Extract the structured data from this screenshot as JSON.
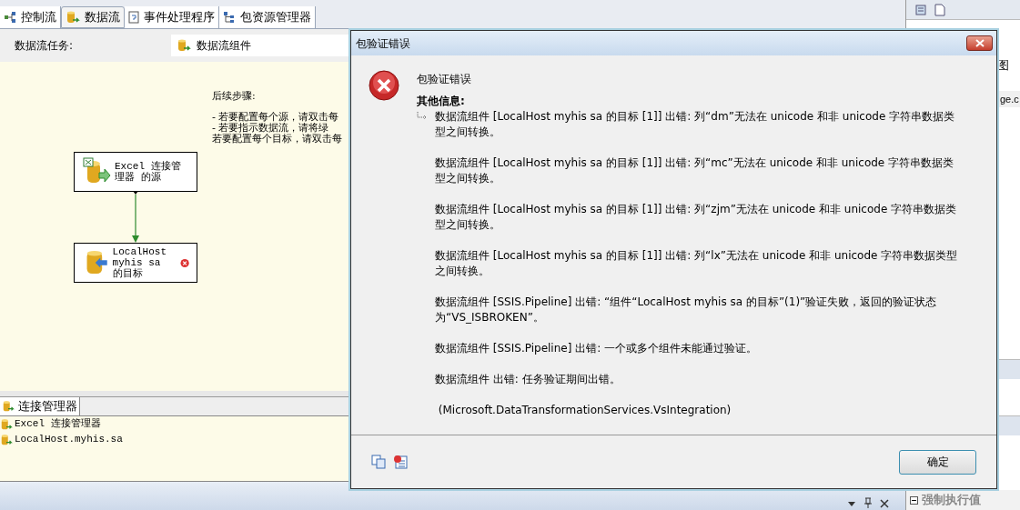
{
  "designer_tabs": [
    {
      "label": "控制流",
      "kind": "control",
      "selected": false
    },
    {
      "label": "数据流",
      "kind": "dataflow",
      "selected": true
    },
    {
      "label": "事件处理程序",
      "kind": "event",
      "selected": false
    },
    {
      "label": "包资源管理器",
      "kind": "tree",
      "selected": false
    }
  ],
  "task_bar": {
    "label": "数据流任务:",
    "combo_value": "数据流组件"
  },
  "canvas": {
    "hint_title": "后续步骤:",
    "hint_lines": [
      "- 若要配置每个源，请双击每",
      "- 若要指示数据流，请将绿",
      "若要配置每个目标，请双击每"
    ],
    "nodes": [
      {
        "kind": "source",
        "label": "Excel 连接管理器 的源",
        "error": false
      },
      {
        "kind": "destination",
        "label": "LocalHost myhis sa 的目标",
        "error": true
      }
    ]
  },
  "connection_managers": {
    "tab": "连接管理器",
    "items": [
      "Excel 连接管理器",
      "LocalHost.myhis.sa"
    ]
  },
  "right_panel": {
    "texts": [
      "图",
      "ge.c"
    ],
    "property": "强制执行值"
  },
  "dialog": {
    "title": "包验证错误",
    "heading": "包验证错误",
    "info_label": "其他信息:",
    "messages": [
      "数据流组件 [LocalHost myhis sa 的目标 [1]] 出错: 列“dm”无法在 unicode 和非 unicode 字符串数据类型之间转换。",
      "数据流组件 [LocalHost myhis sa 的目标 [1]] 出错: 列“mc”无法在 unicode 和非 unicode 字符串数据类型之间转换。",
      "数据流组件 [LocalHost myhis sa 的目标 [1]] 出错: 列“zjm”无法在 unicode 和非 unicode 字符串数据类型之间转换。",
      "数据流组件 [LocalHost myhis sa 的目标 [1]] 出错: 列“lx”无法在 unicode 和非 unicode 字符串数据类型之间转换。",
      "数据流组件 [SSIS.Pipeline] 出错: “组件“LocalHost myhis sa 的目标”(1)”验证失败，返回的验证状态为“VS_ISBROKEN”。",
      "数据流组件 [SSIS.Pipeline] 出错: 一个或多个组件未能通过验证。",
      "数据流组件 出错: 任务验证期间出错。",
      " (Microsoft.DataTransformationServices.VsIntegration)"
    ],
    "ok_button": "确定"
  }
}
